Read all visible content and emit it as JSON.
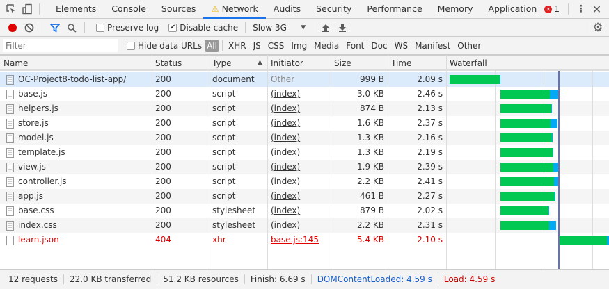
{
  "tabs": {
    "items": [
      "Elements",
      "Console",
      "Sources",
      "Network",
      "Audits",
      "Security",
      "Performance",
      "Memory",
      "Application"
    ],
    "active": "Network",
    "error_count": "1"
  },
  "toolbar": {
    "preserve_log": "Preserve log",
    "preserve_log_checked": false,
    "disable_cache": "Disable cache",
    "disable_cache_checked": true,
    "throttling": "Slow 3G"
  },
  "filterbar": {
    "placeholder": "Filter",
    "value": "",
    "hide_data_urls": "Hide data URLs",
    "types": [
      "All",
      "XHR",
      "JS",
      "CSS",
      "Img",
      "Media",
      "Font",
      "Doc",
      "WS",
      "Manifest",
      "Other"
    ],
    "active_type": "All"
  },
  "columns": [
    "Name",
    "Status",
    "Type",
    "Initiator",
    "Size",
    "Time",
    "Waterfall"
  ],
  "sort": {
    "column": "Type",
    "direction": "ascending"
  },
  "rows": [
    {
      "name": "OC-Project8-todo-list-app/",
      "status": "200",
      "type": "document",
      "initiator": "Other",
      "size": "999 B",
      "time": "2.09 s",
      "selected": true,
      "error": false,
      "wf": [
        0.15,
        2.2,
        2.24
      ]
    },
    {
      "name": "base.js",
      "status": "200",
      "type": "script",
      "initiator": "(index)",
      "size": "3.0 KB",
      "time": "2.46 s",
      "error": false,
      "wf": [
        2.23,
        4.26,
        4.63
      ]
    },
    {
      "name": "helpers.js",
      "status": "200",
      "type": "script",
      "initiator": "(index)",
      "size": "874 B",
      "time": "2.13 s",
      "error": false,
      "wf": [
        2.23,
        4.31,
        4.35
      ]
    },
    {
      "name": "store.js",
      "status": "200",
      "type": "script",
      "initiator": "(index)",
      "size": "1.6 KB",
      "time": "2.37 s",
      "error": false,
      "wf": [
        2.23,
        4.29,
        4.57
      ]
    },
    {
      "name": "model.js",
      "status": "200",
      "type": "script",
      "initiator": "(index)",
      "size": "1.3 KB",
      "time": "2.16 s",
      "error": false,
      "wf": [
        2.23,
        4.33,
        4.37
      ]
    },
    {
      "name": "template.js",
      "status": "200",
      "type": "script",
      "initiator": "(index)",
      "size": "1.3 KB",
      "time": "2.19 s",
      "error": false,
      "wf": [
        2.23,
        4.36,
        4.4
      ]
    },
    {
      "name": "view.js",
      "status": "200",
      "type": "script",
      "initiator": "(index)",
      "size": "1.9 KB",
      "time": "2.39 s",
      "error": false,
      "wf": [
        2.23,
        4.4,
        4.61
      ]
    },
    {
      "name": "controller.js",
      "status": "200",
      "type": "script",
      "initiator": "(index)",
      "size": "2.2 KB",
      "time": "2.41 s",
      "error": false,
      "wf": [
        2.23,
        4.42,
        4.62
      ]
    },
    {
      "name": "app.js",
      "status": "200",
      "type": "script",
      "initiator": "(index)",
      "size": "461 B",
      "time": "2.27 s",
      "error": false,
      "wf": [
        2.23,
        4.46,
        4.49
      ]
    },
    {
      "name": "base.css",
      "status": "200",
      "type": "stylesheet",
      "initiator": "(index)",
      "size": "879 B",
      "time": "2.02 s",
      "error": false,
      "wf": [
        2.23,
        4.19,
        4.23
      ]
    },
    {
      "name": "index.css",
      "status": "200",
      "type": "stylesheet",
      "initiator": "(index)",
      "size": "2.2 KB",
      "time": "2.31 s",
      "error": false,
      "wf": [
        2.23,
        4.23,
        4.51
      ]
    },
    {
      "name": "learn.json",
      "status": "404",
      "type": "xhr",
      "initiator": "base.js:145",
      "size": "5.4 KB",
      "time": "2.10 s",
      "error": true,
      "wf": [
        4.63,
        6.6,
        6.69
      ]
    }
  ],
  "waterfall": {
    "gridlines_s": [
      2,
      4,
      6
    ],
    "dom_content_loaded_s": 4.59,
    "colors": {
      "waiting": "#00c853",
      "download": "#03a9f4",
      "dcl": "#6a73a8"
    }
  },
  "footer": {
    "requests": "12 requests",
    "transferred": "22.0 KB transferred",
    "resources": "51.2 KB resources",
    "finish": "Finish: 6.69 s",
    "dcl": "DOMContentLoaded: 4.59 s",
    "load": "Load: 4.59 s"
  },
  "colors": {
    "accent": "#1a73e8",
    "error": "#e00000",
    "selected_row": "#dcebfc",
    "dcl_text": "#1a5fc8",
    "load_text": "#c80000"
  }
}
